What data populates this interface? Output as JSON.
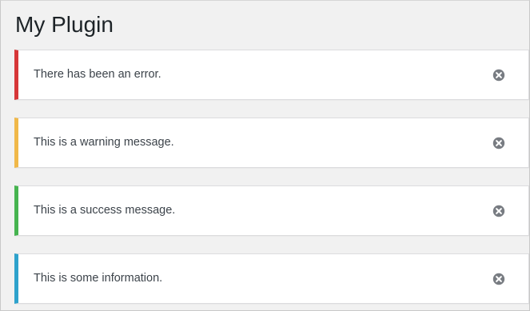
{
  "page": {
    "title": "My Plugin"
  },
  "notices": [
    {
      "type": "error",
      "message": "There has been an error.",
      "accent_color": "#d63638",
      "dismiss_icon": "dismiss-icon"
    },
    {
      "type": "warning",
      "message": "This is a warning message.",
      "accent_color": "#f0b849",
      "dismiss_icon": "dismiss-icon"
    },
    {
      "type": "success",
      "message": "This is a success message.",
      "accent_color": "#46b450",
      "dismiss_icon": "dismiss-icon"
    },
    {
      "type": "info",
      "message": "This is some information.",
      "accent_color": "#2ea2cc",
      "dismiss_icon": "dismiss-icon"
    }
  ],
  "colors": {
    "page_background": "#f1f1f1",
    "notice_background": "#ffffff",
    "dismiss_icon": "#787c82"
  }
}
